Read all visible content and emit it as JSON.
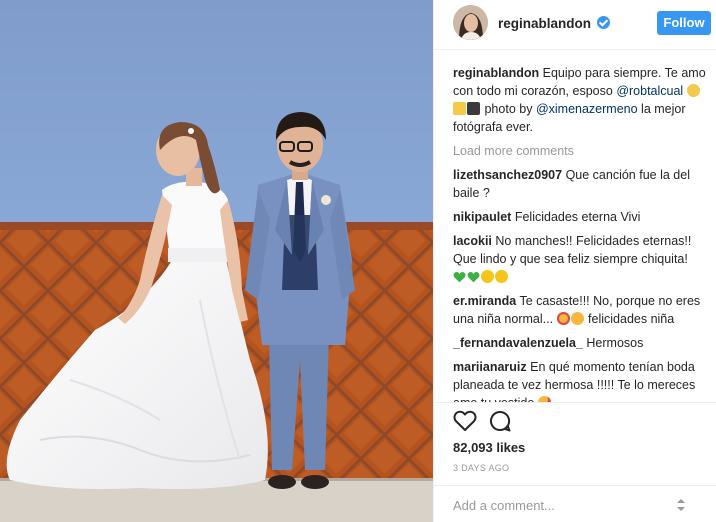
{
  "post": {
    "image_alt": "Bride in a white gown and groom in a blue suit posing against a blue and orange-brick wall"
  },
  "header": {
    "username": "reginablandon",
    "follow_label": "Follow"
  },
  "caption": {
    "username": "reginablandon",
    "text_1": "Equipo para siempre. Te amo con todo mi corazón, esposo",
    "mention_1": "@robtalcual",
    "text_2": "photo by",
    "mention_2": "@ximenazermeno",
    "text_3": "la mejor fotógrafa ever."
  },
  "load_more_label": "Load more comments",
  "comments": [
    {
      "username": "lizethsanchez0907",
      "text": "Que canción fue la del baile ?"
    },
    {
      "username": "nikipaulet",
      "text": "Felicidades eterna Vivi"
    },
    {
      "username": "lacokii",
      "text": "No manches!! Felicidades eternas!! Que lindo y que sea feliz siempre chiquita!"
    },
    {
      "username": "er.miranda",
      "text_1": "Te casaste!!! No, porque no eres una niña normal...",
      "text_2": "felicidades niña"
    },
    {
      "username": "_fernandavalenzuela_",
      "text": "Hermosos"
    },
    {
      "username": "mariianaruiz",
      "text": "En qué momento tenían boda planeada te vez hermosa !!!!! Te lo mereces amo tu vestido"
    }
  ],
  "likes": "82,093 likes",
  "timestamp": "3 DAYS AGO",
  "add_comment": {
    "placeholder": "Add a comment..."
  },
  "icons": {
    "verified": "verified-badge-icon",
    "like": "heart-outline-icon",
    "comment": "speech-bubble-icon",
    "more": "more-options-icon"
  },
  "colors": {
    "accent": "#3897f0",
    "mention": "#003569",
    "muted": "#999999",
    "text": "#262626"
  }
}
